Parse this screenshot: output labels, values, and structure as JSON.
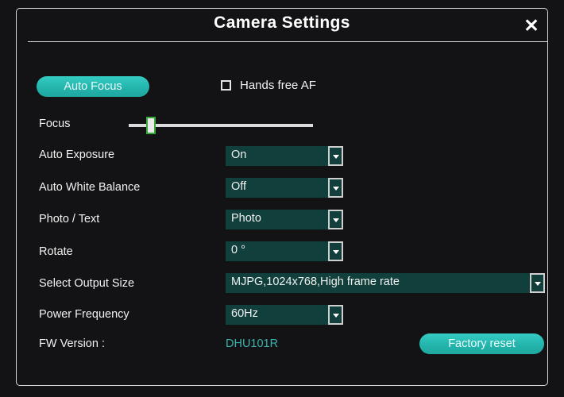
{
  "window": {
    "title": "Camera Settings",
    "close_icon": "close-x-icon"
  },
  "controls": {
    "auto_focus_button": "Auto Focus",
    "hands_free_af_label": "Hands free AF",
    "hands_free_af_checked": false,
    "focus_label": "Focus",
    "focus_value_percent": 10
  },
  "settings": [
    {
      "label": "Auto Exposure",
      "value": "On"
    },
    {
      "label": "Auto White Balance",
      "value": "Off"
    },
    {
      "label": "Photo / Text",
      "value": "Photo"
    },
    {
      "label": "Rotate",
      "value": "0 °"
    },
    {
      "label": "Select Output Size",
      "value": "MJPG,1024x768,High frame rate"
    },
    {
      "label": "Power Frequency",
      "value": "60Hz"
    }
  ],
  "footer": {
    "fw_version_label": "FW Version :",
    "fw_version_value": "DHU101R",
    "factory_reset_button": "Factory reset"
  },
  "colors": {
    "dialog_background": "#131316",
    "accent_teal": "#24b5ad",
    "dropdown_background": "#11403c",
    "text_primary": "#f2f2f2",
    "fw_version_text": "#39b3ab",
    "border": "#d9d9d9",
    "slider_thumb_border": "#37a83a"
  }
}
